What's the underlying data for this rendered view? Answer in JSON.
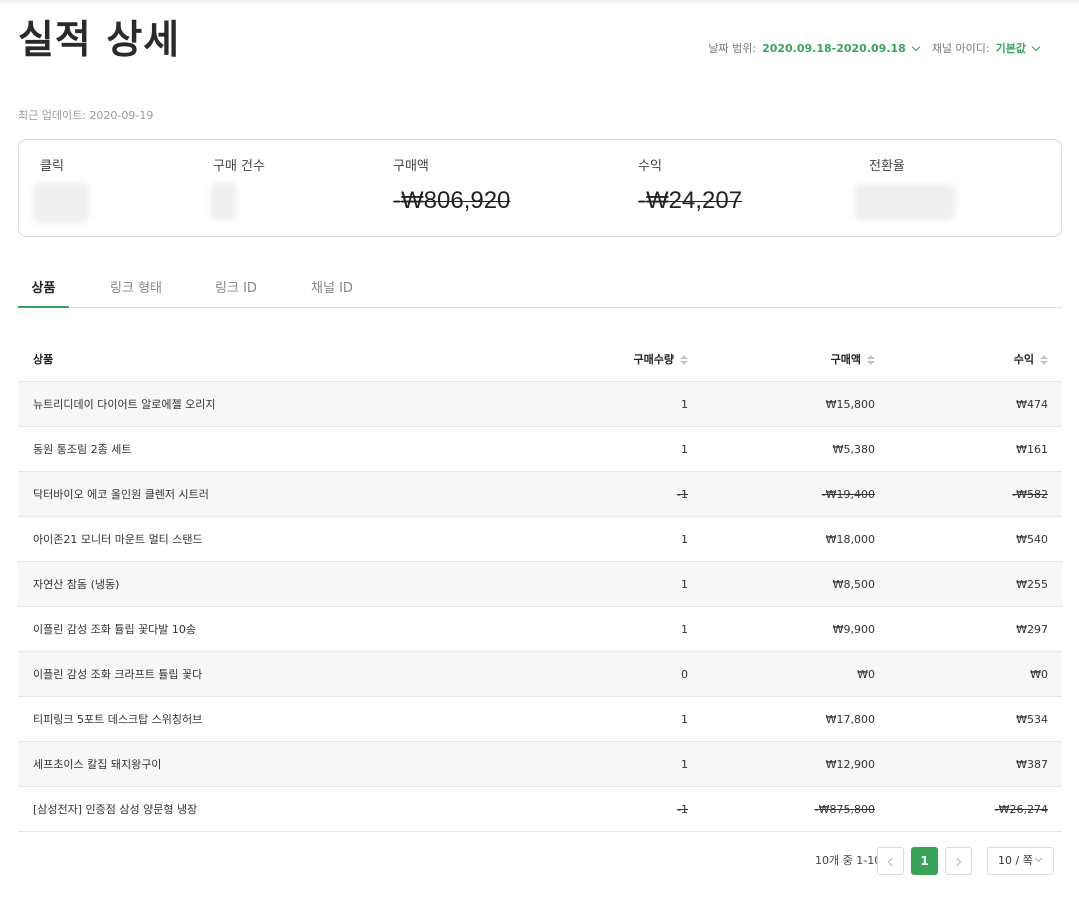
{
  "header": {
    "title": "실적 상세",
    "date_range_label": "날짜 범위:",
    "date_range_value": "2020.09.18-2020.09.18",
    "channel_label": "채널 아이디:",
    "channel_value": "기본값"
  },
  "updated": "최근 업데이트: 2020-09-19",
  "summary": {
    "clicks_label": "클릭",
    "purchases_label": "구매 건수",
    "amount_label": "구매액",
    "amount_value": "-₩806,920",
    "revenue_label": "수익",
    "revenue_value": "-₩24,207",
    "conversion_label": "전환율"
  },
  "tabs": [
    {
      "label": "상품"
    },
    {
      "label": "링크 형태"
    },
    {
      "label": "링크 ID"
    },
    {
      "label": "채널 ID"
    }
  ],
  "table": {
    "headers": {
      "product": "상품",
      "qty": "구매수량",
      "amount": "구매액",
      "revenue": "수익"
    },
    "rows": [
      {
        "product": "뉴트리디데이 다이어트 알로에젤 오리지",
        "qty": "1",
        "amount": "₩15,800",
        "revenue": "₩474"
      },
      {
        "product": "동원 통조림 2종 세트",
        "qty": "1",
        "amount": "₩5,380",
        "revenue": "₩161"
      },
      {
        "product": "닥터바이오 에코 올인원 클렌저 시트러",
        "qty": "-1",
        "amount": "-₩19,400",
        "revenue": "-₩582"
      },
      {
        "product": "아이존21 모니터 마운트 멀티 스탠드",
        "qty": "1",
        "amount": "₩18,000",
        "revenue": "₩540"
      },
      {
        "product": "자연산 참돔 (냉동)",
        "qty": "1",
        "amount": "₩8,500",
        "revenue": "₩255"
      },
      {
        "product": "이플린 감성 조화 튤립 꽃다발 10송",
        "qty": "1",
        "amount": "₩9,900",
        "revenue": "₩297"
      },
      {
        "product": "이플린 감성 조화 크라프트 튤립 꽃다",
        "qty": "0",
        "amount": "₩0",
        "revenue": "₩0"
      },
      {
        "product": "티피링크 5포트 데스크탑 스위칭허브",
        "qty": "1",
        "amount": "₩17,800",
        "revenue": "₩534"
      },
      {
        "product": "세프초이스 칼집 돼지왕구이",
        "qty": "1",
        "amount": "₩12,900",
        "revenue": "₩387"
      },
      {
        "product": "[삼성전자] 인증점 삼성 양문형 냉장",
        "qty": "-1",
        "amount": "-₩875,800",
        "revenue": "-₩26,274"
      }
    ]
  },
  "pagination": {
    "info": "10개 중 1-10",
    "current_page": "1",
    "page_size": "10 / 쪽"
  },
  "colors": {
    "accent": "#3aa35a"
  }
}
